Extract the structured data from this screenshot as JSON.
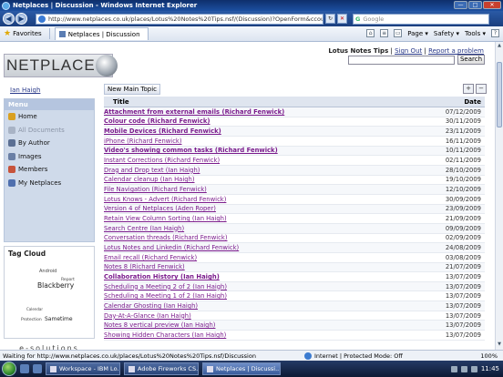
{
  "window": {
    "title": "Netplaces | Discussion - Windows Internet Explorer",
    "minimize": "—",
    "maximize": "□",
    "close": "✕"
  },
  "navbar": {
    "back": "◀",
    "forward": "▶",
    "url": "http://www.netplaces.co.uk/places/Lotus%20Notes%20Tips.nsf/(Discussion)?OpenForm&ccount=-1",
    "refresh": "↻",
    "stop": "✕",
    "search_provider": "G",
    "search_placeholder": "Google"
  },
  "favbar": {
    "favorites_label": "Favorites",
    "tab_label": "Netplaces | Discussion",
    "commands": [
      "Page ▾",
      "Safety ▾",
      "Tools ▾"
    ],
    "help": "?"
  },
  "site": {
    "logo_text": "NETPLACES",
    "site_name": "Lotus Notes Tips",
    "sign_out": "Sign Out",
    "report_problem": "Report a problem",
    "search_button": "Search",
    "username": "Ian Haigh",
    "new_main_topic": "New Main Topic",
    "expand_icon": "+",
    "collapse_icon": "−"
  },
  "leftnav": {
    "header": "Menu",
    "items": [
      {
        "label": "Home",
        "color": "#d9a021"
      },
      {
        "label": "All Documents",
        "color": "#a8b3c5"
      },
      {
        "label": "By Author",
        "color": "#5b6f93"
      },
      {
        "label": "Images",
        "color": "#6a7fa5"
      },
      {
        "label": "Members",
        "color": "#c7533b"
      },
      {
        "label": "My Netplaces",
        "color": "#4f6fae"
      }
    ]
  },
  "tag_cloud": {
    "title": "Tag Cloud",
    "tags": [
      "Android",
      "Blackberry",
      "Report",
      "Protection",
      "Sametime",
      "Calendar"
    ]
  },
  "footer_logo": "e-solutions",
  "grid": {
    "col_title": "Title",
    "col_date": "Date",
    "rows": [
      {
        "title": "Attachment from external emails (Richard Fenwick)",
        "date": "07/12/2009",
        "bold": true
      },
      {
        "title": "Colour code (Richard Fenwick)",
        "date": "30/11/2009",
        "bold": true
      },
      {
        "title": "Mobile Devices (Richard Fenwick)",
        "date": "23/11/2009",
        "bold": true
      },
      {
        "title": "iPhone (Richard Fenwick)",
        "date": "16/11/2009",
        "bold": false
      },
      {
        "title": "Video's showing common tasks (Richard Fenwick)",
        "date": "10/11/2009",
        "bold": true
      },
      {
        "title": "Instant Corrections (Richard Fenwick)",
        "date": "02/11/2009",
        "bold": false
      },
      {
        "title": "Drag and Drop text (Ian Haigh)",
        "date": "28/10/2009",
        "bold": false
      },
      {
        "title": "Calendar cleanup (Ian Haigh)",
        "date": "19/10/2009",
        "bold": false
      },
      {
        "title": "File Navigation (Richard Fenwick)",
        "date": "12/10/2009",
        "bold": false
      },
      {
        "title": "Lotus Knows - Advert (Richard Fenwick)",
        "date": "30/09/2009",
        "bold": false
      },
      {
        "title": "Version 4 of Netplaces (Aden Roper)",
        "date": "23/09/2009",
        "bold": false
      },
      {
        "title": "Retain View Column Sorting (Ian Haigh)",
        "date": "21/09/2009",
        "bold": false
      },
      {
        "title": "Search Centre (Ian Haigh)",
        "date": "09/09/2009",
        "bold": false
      },
      {
        "title": "Conversation threads (Richard Fenwick)",
        "date": "02/09/2009",
        "bold": false
      },
      {
        "title": "Lotus Notes and Linkedin (Richard Fenwick)",
        "date": "24/08/2009",
        "bold": false
      },
      {
        "title": "Email recall (Richard Fenwick)",
        "date": "03/08/2009",
        "bold": false
      },
      {
        "title": "Notes 8 (Richard Fenwick)",
        "date": "21/07/2009",
        "bold": false
      },
      {
        "title": "Collaboration History (Ian Haigh)",
        "date": "13/07/2009",
        "bold": true
      },
      {
        "title": "Scheduling a Meeting 2 of 2 (Ian Haigh)",
        "date": "13/07/2009",
        "bold": false
      },
      {
        "title": "Scheduling a Meeting 1 of 2 (Ian Haigh)",
        "date": "13/07/2009",
        "bold": false
      },
      {
        "title": "Calendar Ghosting (Ian Haigh)",
        "date": "13/07/2009",
        "bold": false
      },
      {
        "title": "Day-At-A-Glance (Ian Haigh)",
        "date": "13/07/2009",
        "bold": false
      },
      {
        "title": "Notes 8 vertical preview (Ian Haigh)",
        "date": "13/07/2009",
        "bold": false
      },
      {
        "title": "Showing Hidden Characters (Ian Haigh)",
        "date": "13/07/2009",
        "bold": false
      }
    ]
  },
  "statusbar": {
    "text": "Waiting for http://www.netplaces.co.uk/places/Lotus%20Notes%20Tips.nsf/Discussion",
    "zone": "Internet | Protected Mode: Off",
    "zoom": "100%"
  },
  "taskbar": {
    "tasks": [
      "Workspace - IBM Lo...",
      "Adobe Fireworks CS...",
      "Netplaces | Discussi..."
    ],
    "clock": "11:45"
  }
}
